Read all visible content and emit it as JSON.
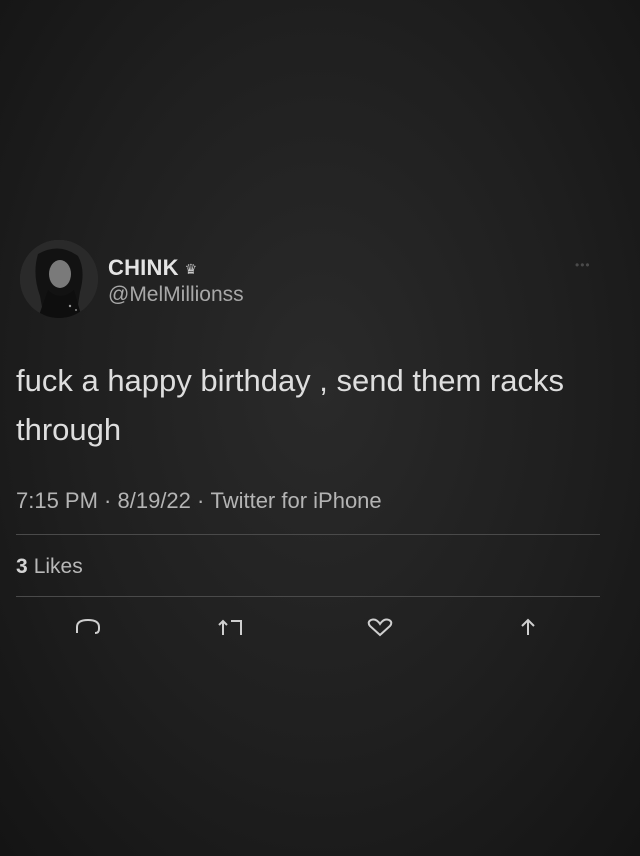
{
  "tweet": {
    "display_name": "CHINK",
    "badge_icon": "crown-icon",
    "handle": "@MelMillionss",
    "text_line1": "fuck a happy birthday , send them racks",
    "text_line2": "through",
    "time": "7:15 PM",
    "separator": " · ",
    "date": "8/19/22",
    "source": "Twitter for iPhone",
    "likes_count": "3",
    "likes_label": "Likes"
  },
  "actions": [
    {
      "icon": "reply-icon"
    },
    {
      "icon": "retweet-icon"
    },
    {
      "icon": "like-icon"
    },
    {
      "icon": "share-icon"
    }
  ],
  "colors": {
    "background": "#1f1f1f",
    "text": "#dedede",
    "muted": "#b4b4b4",
    "divider": "#4a4a4a"
  }
}
